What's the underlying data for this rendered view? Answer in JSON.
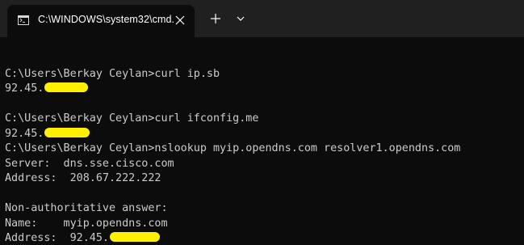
{
  "window": {
    "tab_title": "C:\\WINDOWS\\system32\\cmd.",
    "icons": {
      "tab_icon": "cmd-icon",
      "close": "close-icon",
      "new_tab": "plus-icon",
      "dropdown": "chevron-down-icon"
    }
  },
  "terminal": {
    "lines": [
      "",
      "C:\\Users\\Berkay Ceylan>curl ip.sb",
      "92.45.",
      "",
      "C:\\Users\\Berkay Ceylan>curl ifconfig.me",
      "92.45.",
      "C:\\Users\\Berkay Ceylan>nslookup myip.opendns.com resolver1.opendns.com",
      "Server:  dns.sse.cisco.com",
      "Address:  208.67.222.222",
      "",
      "Non-authoritative answer:",
      "Name:    myip.opendns.com",
      "Address:  92.45."
    ],
    "redaction_color": "#ffef00",
    "text_color": "#cccccc",
    "background_color": "#0c0c0c"
  }
}
